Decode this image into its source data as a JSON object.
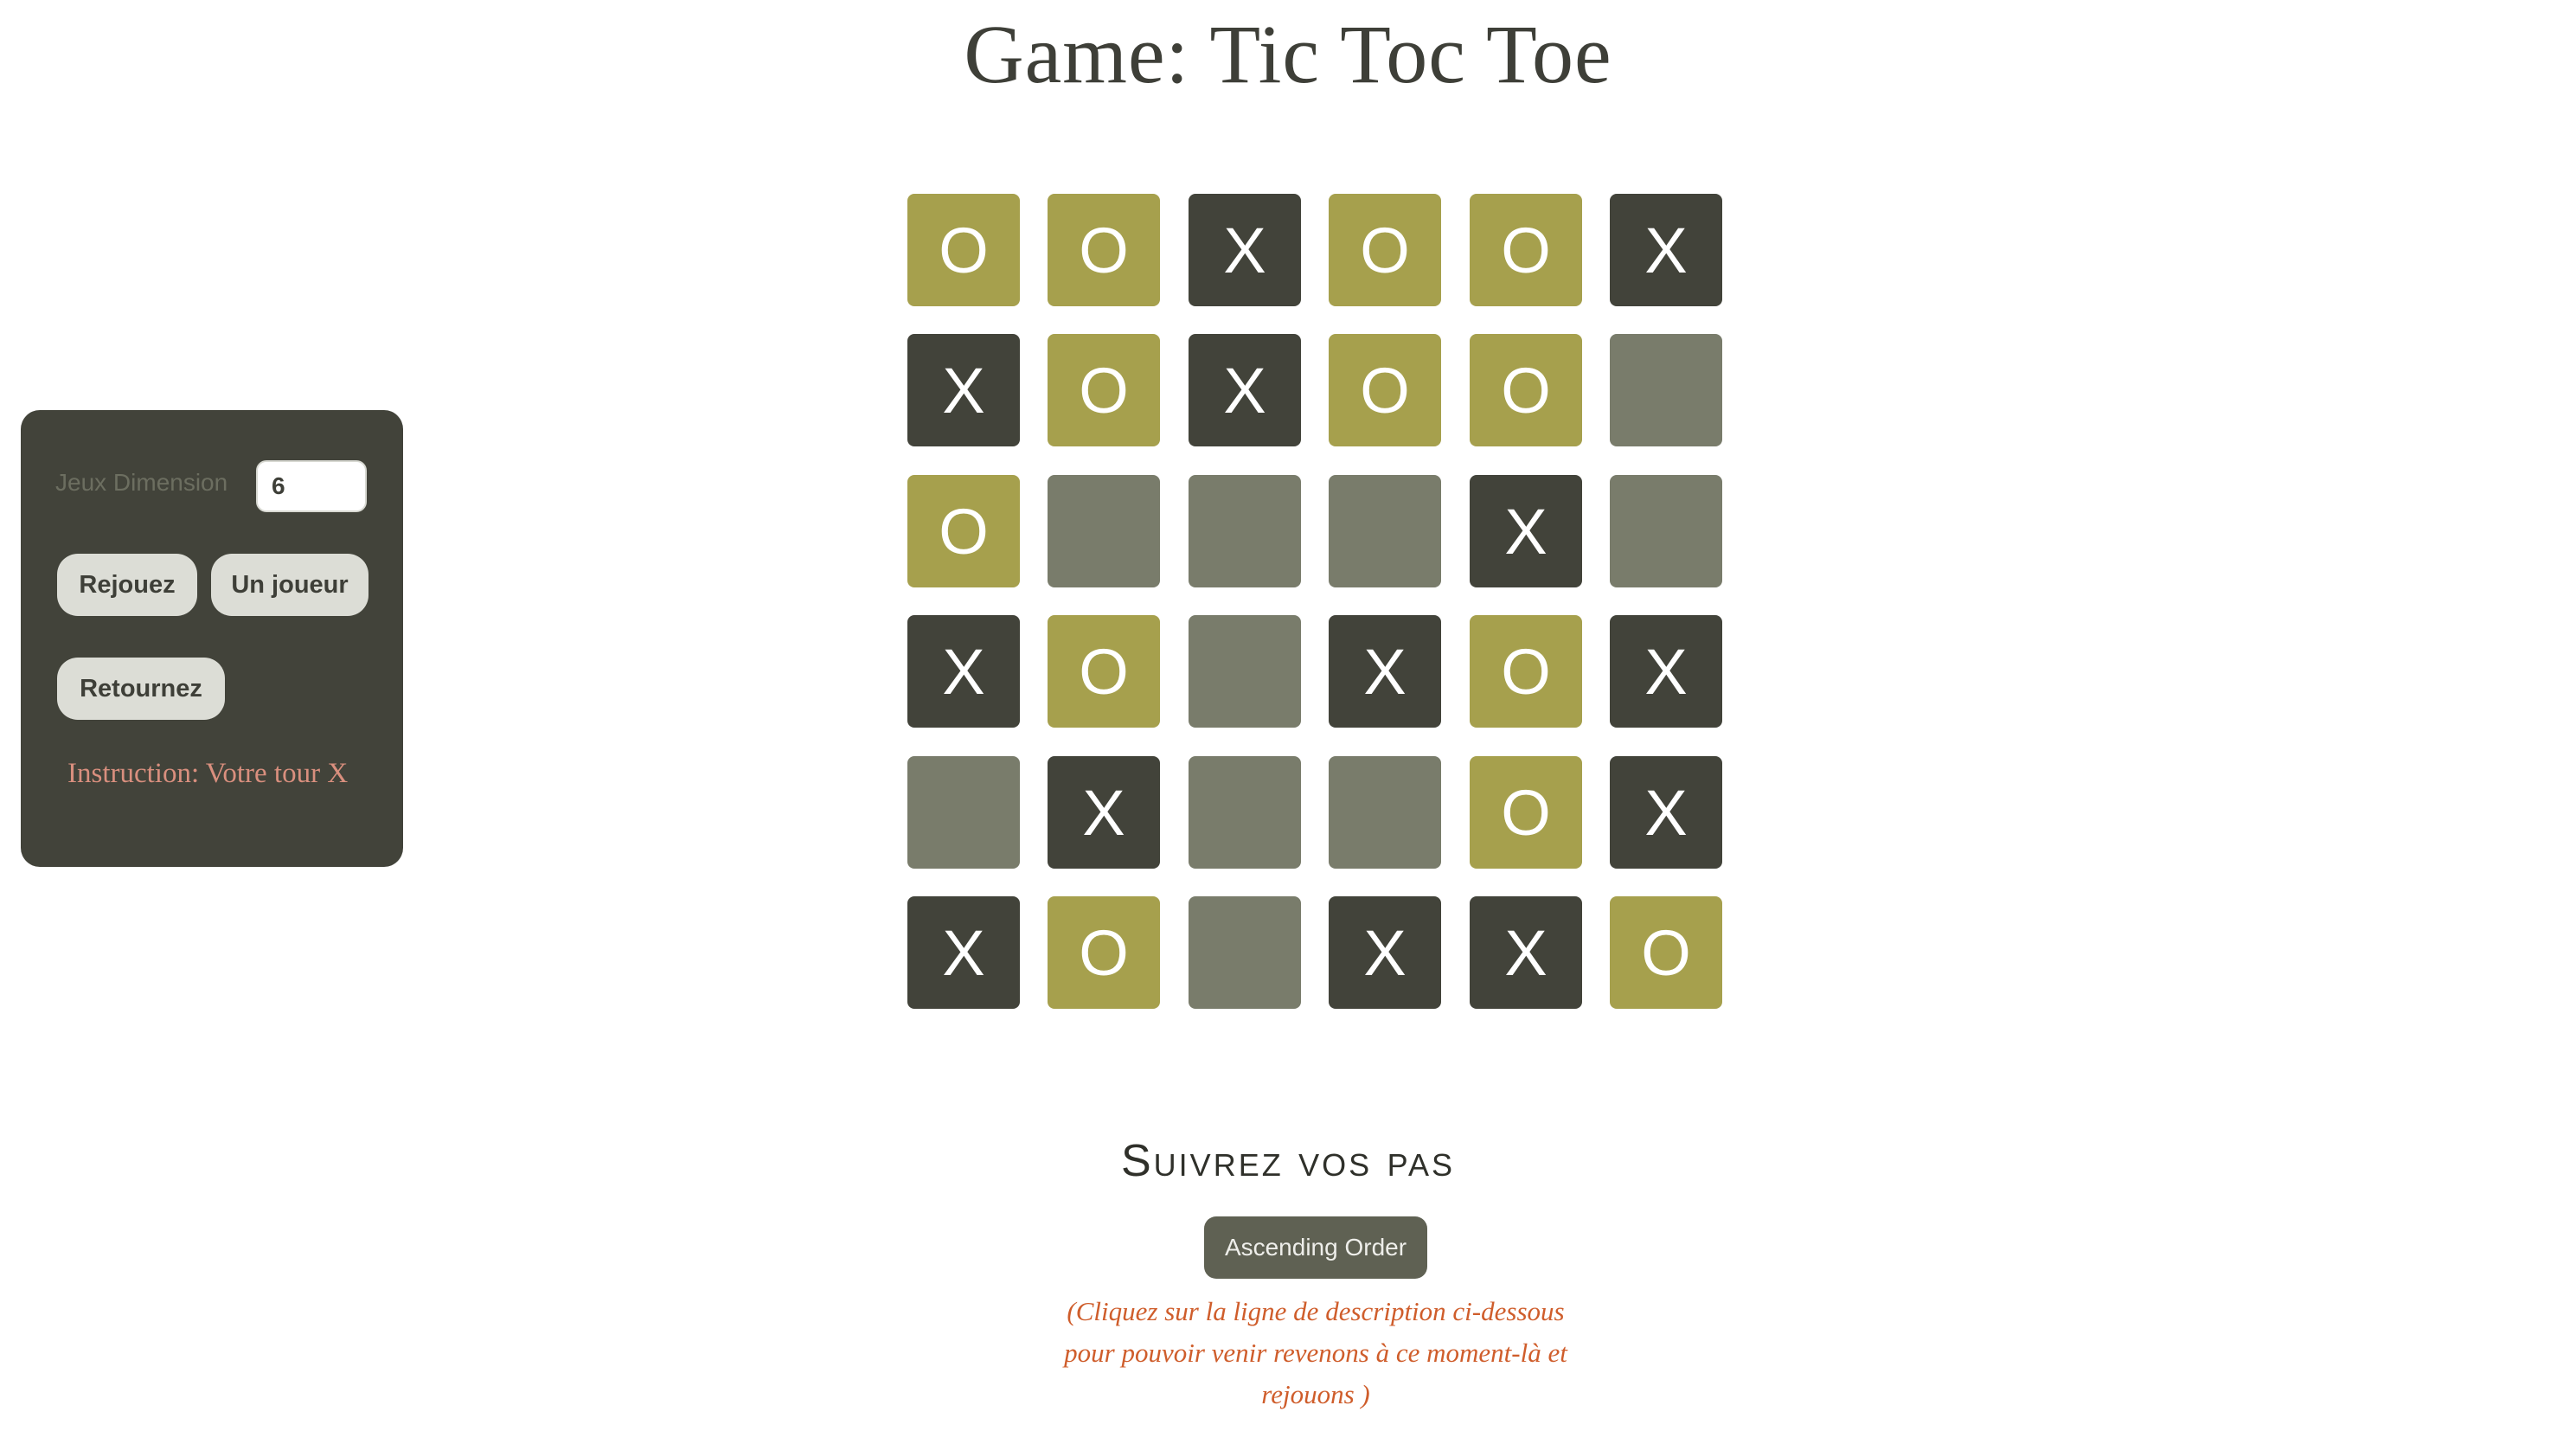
{
  "page_title": "Game: Tic Toc Toe",
  "controls": {
    "dimension_label": "Jeux Dimension",
    "dimension_value": "6",
    "replay_label": "Rejouez",
    "single_player_label": "Un joueur",
    "back_label": "Retournez",
    "instruction": "Instruction: Votre tour X"
  },
  "board": {
    "size": 6,
    "cells": [
      [
        "O",
        "O",
        "X",
        "O",
        "O",
        "X"
      ],
      [
        "X",
        "O",
        "X",
        "O",
        "O",
        ""
      ],
      [
        "O",
        "",
        "",
        "",
        "X",
        ""
      ],
      [
        "X",
        "O",
        "",
        "X",
        "O",
        "X"
      ],
      [
        "",
        "X",
        "",
        "",
        "O",
        "X"
      ],
      [
        "X",
        "O",
        "",
        "X",
        "X",
        "O"
      ]
    ]
  },
  "history": {
    "title": "Suivrez vos pas",
    "order_button_label": "Ascending Order",
    "hint": "(Cliquez sur la ligne de description ci-dessous pour pouvoir venir revenons à ce moment-là et rejouons )"
  },
  "colors": {
    "x_cell": "#42433a",
    "o_cell": "#a6a04d",
    "empty_cell": "#797c6b",
    "panel": "#42433a",
    "instruction": "#d98f7e",
    "hint": "#cf5d2b"
  }
}
